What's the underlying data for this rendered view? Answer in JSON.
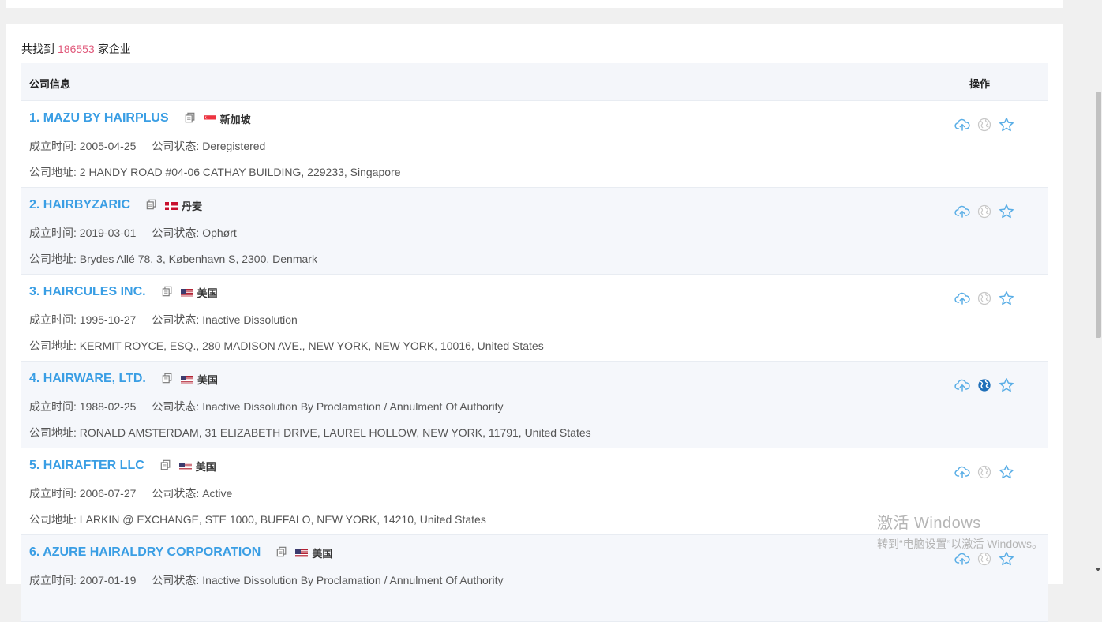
{
  "summary": {
    "prefix": "共找到",
    "count": "186553",
    "suffix": "家企业"
  },
  "table": {
    "header_info": "公司信息",
    "header_ops": "操作"
  },
  "labels": {
    "founded": "成立时间:",
    "status": "公司状态:",
    "address": "公司地址:"
  },
  "companies": [
    {
      "name": "1. MAZU BY HAIRPLUS",
      "country": "新加坡",
      "flag": "sg",
      "founded": "2005-04-25",
      "status": "Deregistered",
      "address": "2 HANDY ROAD #04-06 CATHAY BUILDING, 229233, Singapore",
      "web_active": false
    },
    {
      "name": "2. HAIRBYZARIC",
      "country": "丹麦",
      "flag": "dk",
      "founded": "2019-03-01",
      "status": "Ophørt",
      "address": "Brydes Allé 78, 3, København S, 2300, Denmark",
      "web_active": false
    },
    {
      "name": "3. HAIRCULES INC.",
      "country": "美国",
      "flag": "us",
      "founded": "1995-10-27",
      "status": "Inactive Dissolution",
      "address": "KERMIT ROYCE, ESQ., 280 MADISON AVE., NEW YORK, NEW YORK, 10016, United States",
      "web_active": false
    },
    {
      "name": "4. HAIRWARE, LTD.",
      "country": "美国",
      "flag": "us",
      "founded": "1988-02-25",
      "status": "Inactive Dissolution By Proclamation / Annulment Of Authority",
      "address": "RONALD AMSTERDAM, 31 ELIZABETH DRIVE, LAUREL HOLLOW, NEW YORK, 11791, United States",
      "web_active": true
    },
    {
      "name": "5. HAIRAFTER LLC",
      "country": "美国",
      "flag": "us",
      "founded": "2006-07-27",
      "status": "Active",
      "address": "LARKIN @ EXCHANGE, STE 1000, BUFFALO, NEW YORK, 14210, United States",
      "web_active": false
    },
    {
      "name": "6. AZURE HAIRALDRY CORPORATION",
      "country": "美国",
      "flag": "us",
      "founded": "2007-01-19",
      "status": "Inactive Dissolution By Proclamation / Annulment Of Authority",
      "address": "",
      "web_active": false
    }
  ],
  "watermark": {
    "line1": "激活 Windows",
    "line2": "转到“电脑设置”以激活 Windows。"
  },
  "colors": {
    "link": "#3a9ee4",
    "count": "#e0587a",
    "icon_blue": "#5aaee6",
    "icon_gray": "#c8c8c8",
    "globe_active": "#1f6fb8"
  }
}
